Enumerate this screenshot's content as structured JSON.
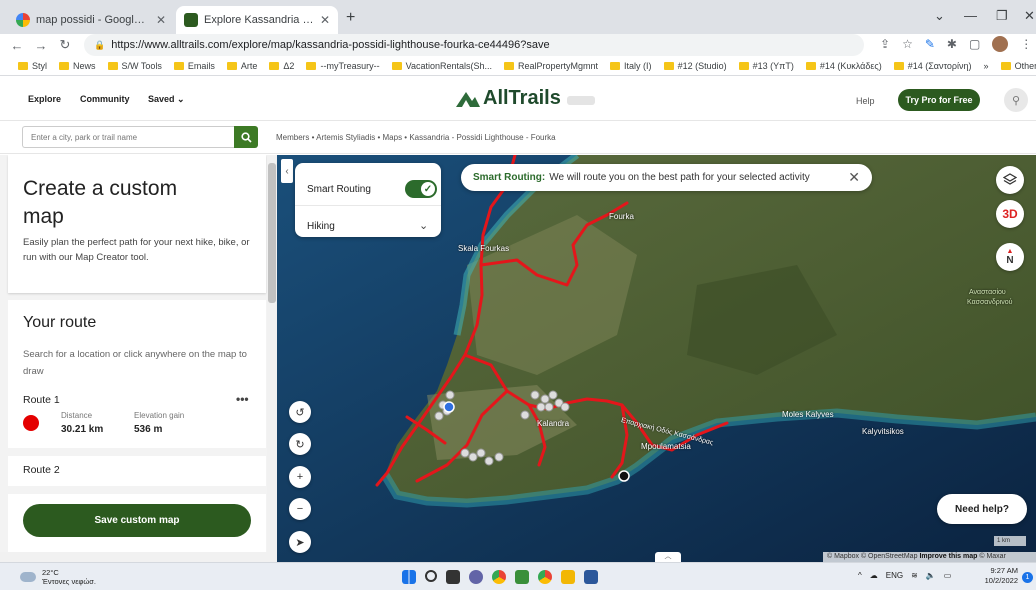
{
  "browser": {
    "tabs": [
      {
        "title": "map possidi - Google Search",
        "active": false,
        "favicon": "google-icon"
      },
      {
        "title": "Explore Kassandria - Possidi Ligh",
        "active": true,
        "favicon": "alltrails-icon"
      }
    ],
    "url": "https://www.alltrails.com/explore/map/kassandria-possidi-lighthouse-fourka-ce44496?save",
    "bookmarks": [
      "Styl",
      "News",
      "S/W Tools",
      "Emails",
      "Arte",
      "Δ2",
      "--myTreasury--",
      "VacationRentals(Sh...",
      "RealPropertyMgmnt",
      "Italy (I)",
      "#12 (Studio)",
      "#13 (ΥπΤ)",
      "#14 (Κυκλάδες)",
      "#14 (Σαντορίνη)"
    ],
    "bookmarks_more": "»",
    "other_bookmarks": "Other bookmarks"
  },
  "header": {
    "nav": [
      "Explore",
      "Community",
      "Saved"
    ],
    "logo": "AllTrails",
    "help": "Help",
    "try_pro": "Try Pro for Free"
  },
  "search": {
    "placeholder": "Enter a city, park or trail name"
  },
  "breadcrumb": "Members • Artemis Styliadis • Maps • Kassandria - Possidi Lighthouse - Fourka",
  "panel": {
    "title": "Create a custom map",
    "description": "Easily plan the perfect path for your next hike, bike, or run with our Map Creator tool.",
    "your_route": "Your route",
    "route_hint": "Search for a location or click anywhere on the map to draw",
    "route1": {
      "name": "Route 1",
      "menu": "•••",
      "distance_label": "Distance",
      "distance": "30.21 km",
      "elevation_label": "Elevation gain",
      "elevation": "536 m",
      "color": "#e40000"
    },
    "route2": {
      "name": "Route 2"
    },
    "save_button": "Save custom map"
  },
  "map": {
    "smart_routing_label": "Smart Routing",
    "activity": "Hiking",
    "banner_bold": "Smart Routing:",
    "banner_text": "We will route you on the best path for your selected activity",
    "places": {
      "fourka": "Fourka",
      "skala": "Skala Fourkas",
      "kalandra": "Kalandra",
      "moles": "Moles Kalyves",
      "kalyvitsikos": "Kalyvitsikos",
      "mpoulamatsia": "Mpoulamatsia",
      "road": "Επαρχιακή Οδός Κασσάνδρας",
      "anastasiou": "Αναστασίου",
      "kassandrinou": "Κασσανδρινού"
    },
    "three_d": "3D",
    "compass": "N",
    "need_help": "Need help?",
    "scale": "1 km",
    "attribution_plain": "© Mapbox © OpenStreetMap",
    "attribution_bold": "Improve this map",
    "attribution_end": "© Maxar"
  },
  "taskbar": {
    "temp": "22°C",
    "weather": "Έντονες νεφώσ.",
    "lang": "ENG",
    "time": "9:27 AM",
    "date": "10/2/2022",
    "notifications": "1"
  }
}
